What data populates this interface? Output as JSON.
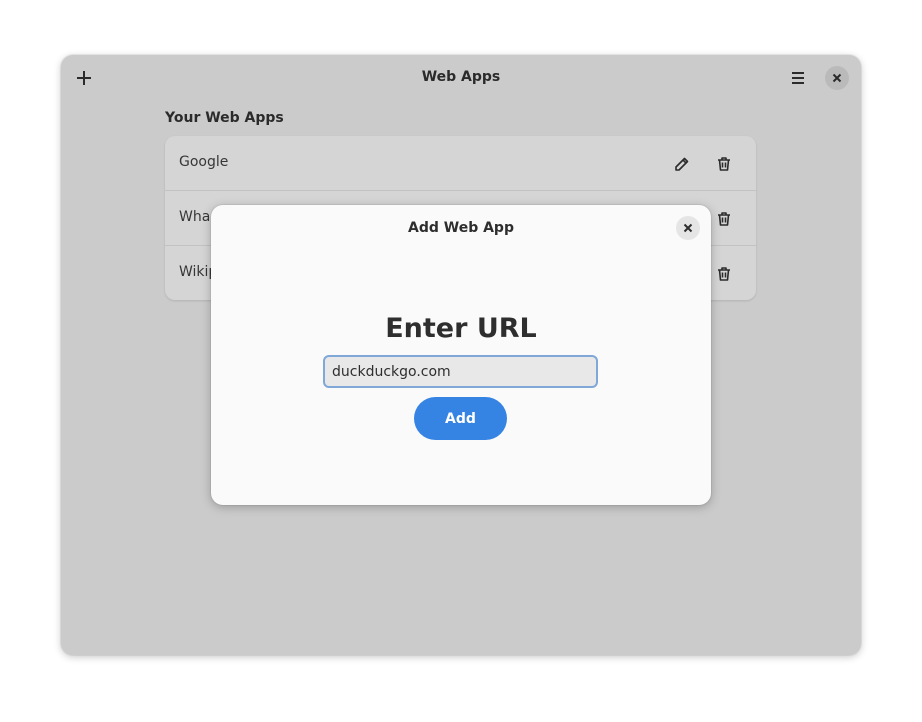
{
  "window": {
    "title": "Web Apps",
    "add_icon": "plus-icon",
    "menu_icon": "hamburger-menu-icon",
    "close_icon": "close-icon"
  },
  "main": {
    "section_title": "Your Web Apps",
    "apps": [
      {
        "name": "Google",
        "edit_icon": "pencil-icon",
        "delete_icon": "trash-icon"
      },
      {
        "name": "Wha",
        "delete_icon": "trash-icon"
      },
      {
        "name": "Wikip",
        "delete_icon": "trash-icon"
      }
    ]
  },
  "dialog": {
    "title": "Add Web App",
    "heading": "Enter URL",
    "url_value": "duckduckgo.com",
    "add_label": "Add"
  },
  "colors": {
    "accent": "#3584e4",
    "window_bg": "#d8d8d8",
    "dialog_bg": "#fafafa",
    "focus_border": "#7fa7d8"
  }
}
